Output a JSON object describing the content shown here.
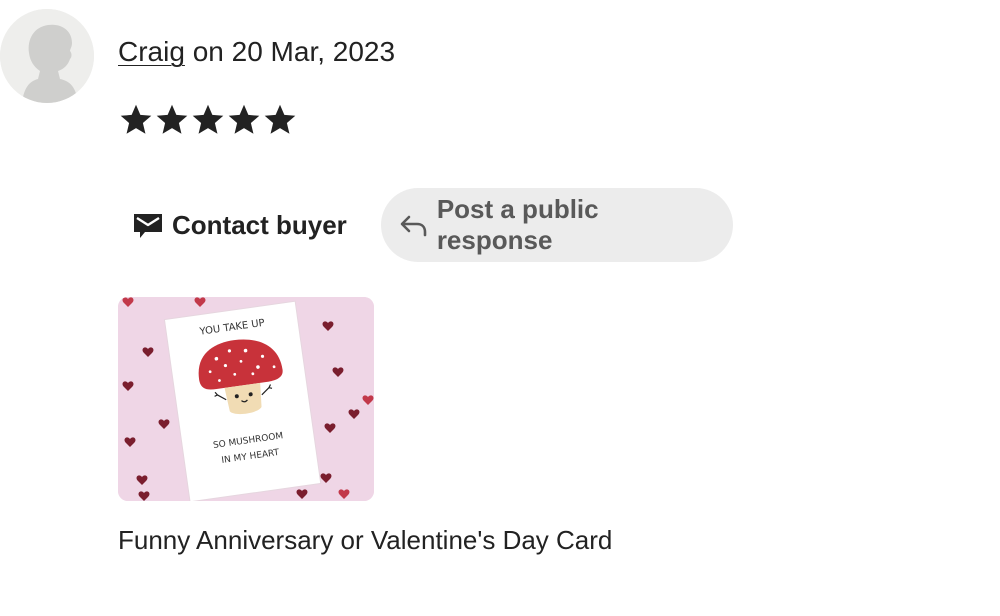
{
  "review": {
    "author": "Craig",
    "date_prefix": " on ",
    "date": "20 Mar, 2023",
    "rating": 5,
    "rating_max": 5
  },
  "actions": {
    "contact_label": "Contact buyer",
    "response_label": "Post a public response"
  },
  "photo": {
    "card_line_1": "YOU TAKE UP",
    "card_line_2": "SO MUSHROOM",
    "card_line_3": "IN MY HEART"
  },
  "product": {
    "title": "Funny Anniversary or Valentine's Day Card"
  },
  "icons": {
    "avatar": "user-silhouette-icon",
    "star": "star-icon",
    "contact": "envelope-icon",
    "response": "reply-arrow-icon"
  },
  "colors": {
    "text": "#222222",
    "muted_text": "#595959",
    "pill_bg": "#ececec",
    "star": "#222222",
    "photo_bg": "#efd6e6",
    "mushroom_cap": "#c8323a"
  }
}
